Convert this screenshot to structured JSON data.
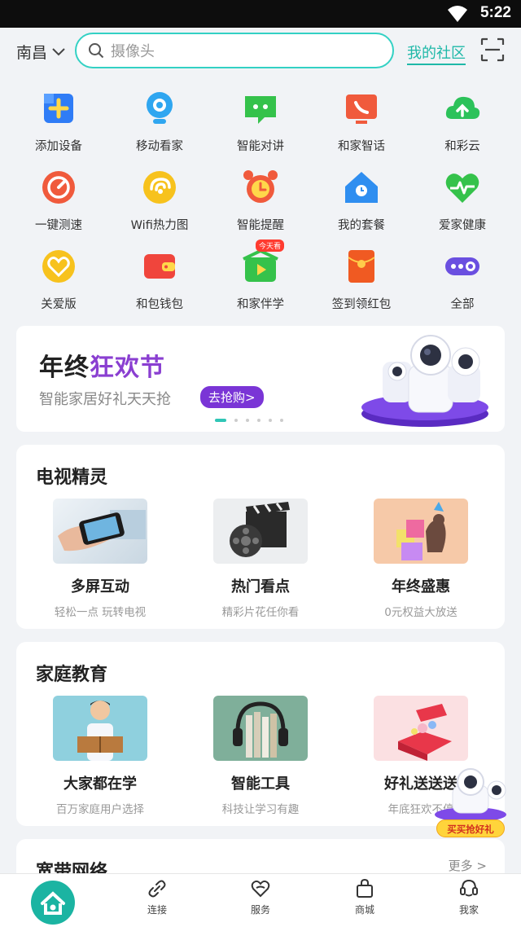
{
  "status_bar": {
    "time": "5:22"
  },
  "header": {
    "city": "南昌",
    "search_placeholder": "摄像头",
    "community_link": "我的社区"
  },
  "shortcuts": [
    {
      "label": "添加设备",
      "icon": "add-device-icon",
      "color": "#2f7cf6"
    },
    {
      "label": "移动看家",
      "icon": "camera-icon",
      "color": "#2fa6f0"
    },
    {
      "label": "智能对讲",
      "icon": "chat-icon",
      "color": "#35c24b"
    },
    {
      "label": "和家智话",
      "icon": "tv-phone-icon",
      "color": "#f05a3c"
    },
    {
      "label": "和彩云",
      "icon": "cloud-upload-icon",
      "color": "#2cc25a"
    },
    {
      "label": "一键测速",
      "icon": "speed-gauge-icon",
      "color": "#f05a3c"
    },
    {
      "label": "Wifi热力图",
      "icon": "wifi-heat-icon",
      "color": "#f7c21d"
    },
    {
      "label": "智能提醒",
      "icon": "alarm-clock-icon",
      "color": "#f05a3c"
    },
    {
      "label": "我的套餐",
      "icon": "home-plan-icon",
      "color": "#2f8ef0"
    },
    {
      "label": "爱家健康",
      "icon": "heart-health-icon",
      "color": "#35c24b"
    },
    {
      "label": "关爱版",
      "icon": "care-heart-icon",
      "color": "#f7c21d"
    },
    {
      "label": "和包钱包",
      "icon": "wallet-icon",
      "color": "#f0453c"
    },
    {
      "label": "和家伴学",
      "icon": "study-play-icon",
      "color": "#35c24b",
      "badge": "今天看"
    },
    {
      "label": "签到领红包",
      "icon": "red-envelope-icon",
      "color": "#f05a22"
    },
    {
      "label": "全部",
      "icon": "more-toggle-icon",
      "color": "#6a4fe0"
    }
  ],
  "banner": {
    "title_pre": "年终",
    "title_highlight": "狂欢节",
    "subtitle": "智能家居好礼天天抢",
    "cta": "去抢购>",
    "page_count": 6,
    "active_page": 1
  },
  "tv_section": {
    "title": "电视精灵",
    "items": [
      {
        "title": "多屏互动",
        "subtitle": "轻松一点 玩转电视"
      },
      {
        "title": "热门看点",
        "subtitle": "精彩片花任你看"
      },
      {
        "title": "年终盛惠",
        "subtitle": "0元权益大放送"
      }
    ]
  },
  "edu_section": {
    "title": "家庭教育",
    "items": [
      {
        "title": "大家都在学",
        "subtitle": "百万家庭用户选择"
      },
      {
        "title": "智能工具",
        "subtitle": "科技让学习有趣"
      },
      {
        "title": "好礼送送送",
        "subtitle": "年底狂欢不停"
      }
    ]
  },
  "broadband_section": {
    "title": "宽带网络",
    "more": "更多 >"
  },
  "floating_promo": {
    "label": "买买抢好礼"
  },
  "tab_bar": {
    "tabs": [
      {
        "label": "连接",
        "icon": "link-icon"
      },
      {
        "label": "服务",
        "icon": "service-heart-icon"
      },
      {
        "label": "商城",
        "icon": "shopping-bag-icon"
      },
      {
        "label": "我家",
        "icon": "my-home-icon"
      }
    ]
  }
}
